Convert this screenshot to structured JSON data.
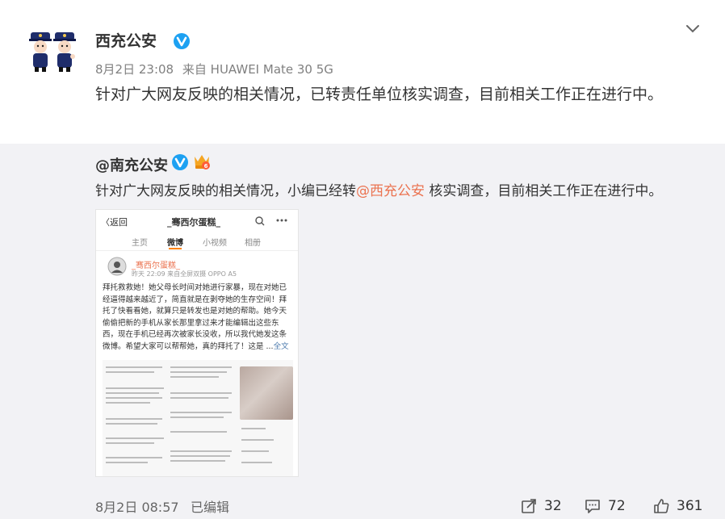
{
  "post": {
    "author": "西充公安",
    "time": "8月2日 23:08",
    "source_prefix": "来自",
    "source": "HUAWEI Mate 30 5G",
    "text": "针对广大网友反映的相关情况，已转责任单位核实调查，目前相关工作正在进行中。"
  },
  "repost": {
    "author": "@南充公安",
    "text_before": "针对广大网友反映的相关情况，小编已经转",
    "mention": "@西充公安",
    "text_after": " 核实调查，目前相关工作正在进行中。",
    "image": {
      "back_label": "〈返回",
      "title": "_骞西尔蛋糕_",
      "tabs": [
        "主页",
        "微博",
        "小视频",
        "相册"
      ],
      "active_tab": "微博",
      "user_name": "_骞西尔蛋糕_",
      "user_meta": "昨天 22:09  来自全屏双摄 OPPO A5",
      "body": "拜托救救她！她父母长时间对她进行家暴，现在对她已经逼得越来越近了，简直就是在剥夺她的生存空间！拜托了快看看她，就算只是转发也是对她的帮助。她今天偷偷把新的手机从家长那里拿过来才能编辑出这些东西，现在手机已经再次被家长没收，所以我代她发这条微博。希望大家可以帮帮她，真的拜托了！这是 ...",
      "more": "全文"
    },
    "footer": {
      "time": "8月2日 08:57",
      "edited": "已编辑",
      "reposts": "32",
      "comments": "72",
      "likes": "361"
    }
  },
  "colors": {
    "accent": "#eb7350",
    "verified": "#1da1f2",
    "repost_bg": "#f2f2f5"
  },
  "icons": {
    "more": "chevron-down-icon",
    "verified": "verified-badge-icon",
    "repost": "share-icon",
    "comment": "comment-icon",
    "like": "thumbs-up-icon"
  }
}
